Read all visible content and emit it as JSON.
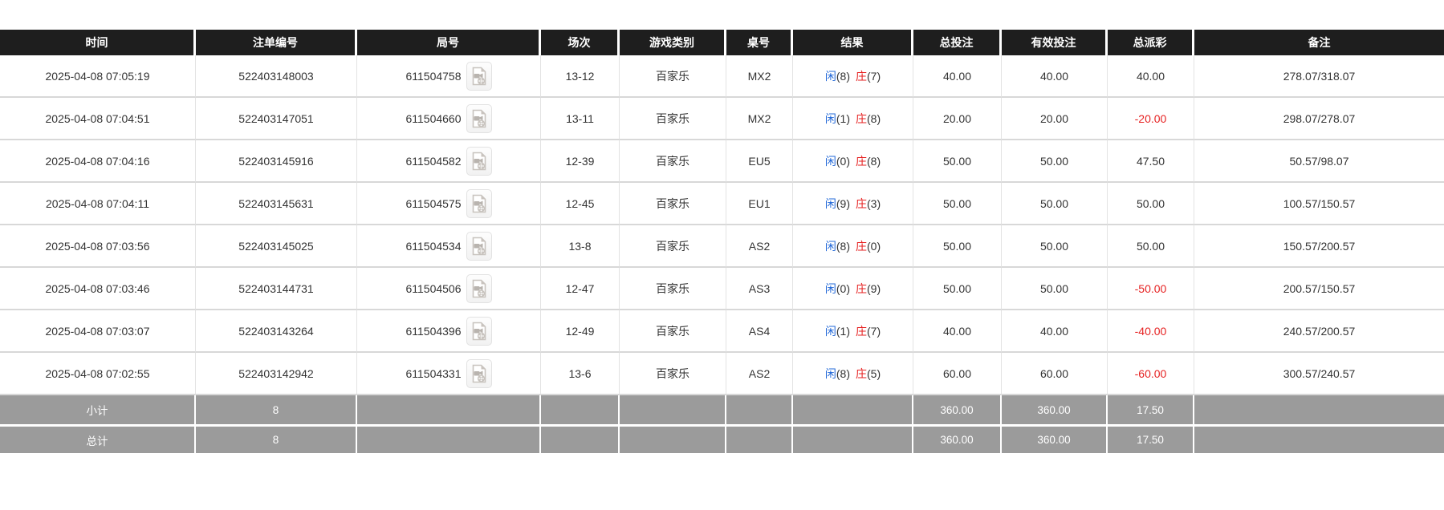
{
  "table": {
    "headers": [
      "时间",
      "注单编号",
      "局号",
      "场次",
      "游戏类别",
      "桌号",
      "结果",
      "总投注",
      "有效投注",
      "总派彩",
      "备注"
    ],
    "rows": [
      {
        "time": "2025-04-08 07:05:19",
        "bet_id": "522403148003",
        "round_no": "611504758",
        "session": "13-12",
        "game_type": "百家乐",
        "table_no": "MX2",
        "result": {
          "player": "闲",
          "player_pts": "(8)",
          "banker": "庄",
          "banker_pts": "(7)"
        },
        "total_bet": "40.00",
        "valid_bet": "40.00",
        "payout": "40.00",
        "remark": "278.07/318.07"
      },
      {
        "time": "2025-04-08 07:04:51",
        "bet_id": "522403147051",
        "round_no": "611504660",
        "session": "13-11",
        "game_type": "百家乐",
        "table_no": "MX2",
        "result": {
          "player": "闲",
          "player_pts": "(1)",
          "banker": "庄",
          "banker_pts": "(8)"
        },
        "total_bet": "20.00",
        "valid_bet": "20.00",
        "payout": "-20.00",
        "remark": "298.07/278.07"
      },
      {
        "time": "2025-04-08 07:04:16",
        "bet_id": "522403145916",
        "round_no": "611504582",
        "session": "12-39",
        "game_type": "百家乐",
        "table_no": "EU5",
        "result": {
          "player": "闲",
          "player_pts": "(0)",
          "banker": "庄",
          "banker_pts": "(8)"
        },
        "total_bet": "50.00",
        "valid_bet": "50.00",
        "payout": "47.50",
        "remark": "50.57/98.07"
      },
      {
        "time": "2025-04-08 07:04:11",
        "bet_id": "522403145631",
        "round_no": "611504575",
        "session": "12-45",
        "game_type": "百家乐",
        "table_no": "EU1",
        "result": {
          "player": "闲",
          "player_pts": "(9)",
          "banker": "庄",
          "banker_pts": "(3)"
        },
        "total_bet": "50.00",
        "valid_bet": "50.00",
        "payout": "50.00",
        "remark": "100.57/150.57"
      },
      {
        "time": "2025-04-08 07:03:56",
        "bet_id": "522403145025",
        "round_no": "611504534",
        "session": "13-8",
        "game_type": "百家乐",
        "table_no": "AS2",
        "result": {
          "player": "闲",
          "player_pts": "(8)",
          "banker": "庄",
          "banker_pts": "(0)"
        },
        "total_bet": "50.00",
        "valid_bet": "50.00",
        "payout": "50.00",
        "remark": "150.57/200.57"
      },
      {
        "time": "2025-04-08 07:03:46",
        "bet_id": "522403144731",
        "round_no": "611504506",
        "session": "12-47",
        "game_type": "百家乐",
        "table_no": "AS3",
        "result": {
          "player": "闲",
          "player_pts": "(0)",
          "banker": "庄",
          "banker_pts": "(9)"
        },
        "total_bet": "50.00",
        "valid_bet": "50.00",
        "payout": "-50.00",
        "remark": "200.57/150.57"
      },
      {
        "time": "2025-04-08 07:03:07",
        "bet_id": "522403143264",
        "round_no": "611504396",
        "session": "12-49",
        "game_type": "百家乐",
        "table_no": "AS4",
        "result": {
          "player": "闲",
          "player_pts": "(1)",
          "banker": "庄",
          "banker_pts": "(7)"
        },
        "total_bet": "40.00",
        "valid_bet": "40.00",
        "payout": "-40.00",
        "remark": "240.57/200.57"
      },
      {
        "time": "2025-04-08 07:02:55",
        "bet_id": "522403142942",
        "round_no": "611504331",
        "session": "13-6",
        "game_type": "百家乐",
        "table_no": "AS2",
        "result": {
          "player": "闲",
          "player_pts": "(8)",
          "banker": "庄",
          "banker_pts": "(5)"
        },
        "total_bet": "60.00",
        "valid_bet": "60.00",
        "payout": "-60.00",
        "remark": "300.57/240.57"
      }
    ],
    "footer": [
      {
        "label": "小计",
        "count": "8",
        "total_bet": "360.00",
        "valid_bet": "360.00",
        "payout": "17.50"
      },
      {
        "label": "总计",
        "count": "8",
        "total_bet": "360.00",
        "valid_bet": "360.00",
        "payout": "17.50"
      }
    ],
    "colors": {
      "header_bg": "#1e1e1e",
      "footer_bg": "#9b9b9b",
      "bet_blue": "#2268d8",
      "loss_red": "#e62222"
    }
  }
}
